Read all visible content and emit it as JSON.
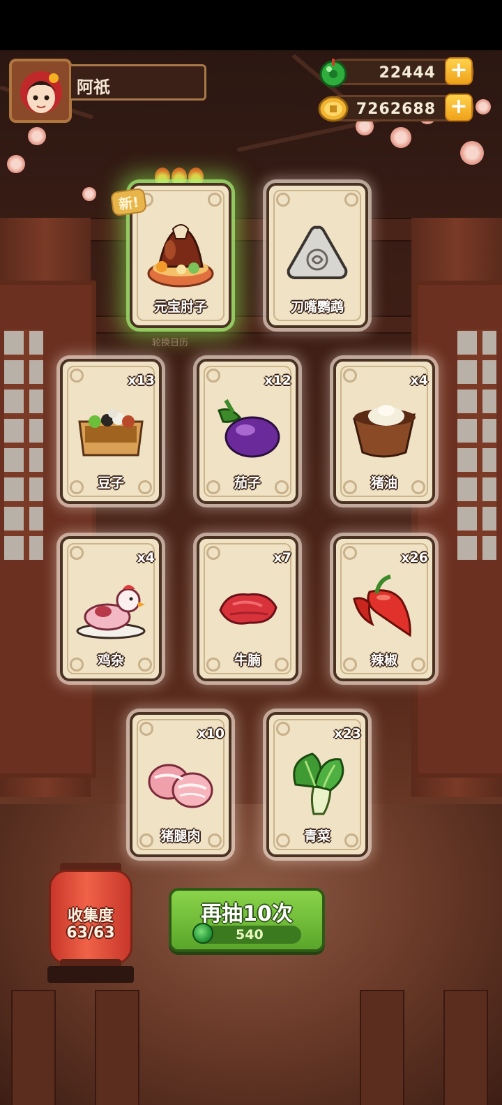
{
  "player": {
    "name": "阿祇",
    "avatar_icon": "chef-girl-avatar-icon"
  },
  "currencies": [
    {
      "name": "jade",
      "icon": "jade-coin-icon",
      "value": "22444",
      "color": "#2fae3e"
    },
    {
      "name": "gold",
      "icon": "gold-coin-icon",
      "value": "7262688",
      "color": "#f2b531"
    }
  ],
  "featured": {
    "new_badge": "新!",
    "calendar_label": "轮换日历",
    "cards": [
      {
        "name": "元宝肘子",
        "icon": "braised-pork-knuckle-icon",
        "highlight": true
      },
      {
        "name": "刀嘴鹦鹉",
        "icon": "locked-triangle-icon",
        "highlight": false
      }
    ]
  },
  "cards": [
    {
      "name": "豆子",
      "qty": "x13",
      "icon": "beans-box-icon"
    },
    {
      "name": "茄子",
      "qty": "x12",
      "icon": "eggplant-icon"
    },
    {
      "name": "猪油",
      "qty": "x4",
      "icon": "lard-bowl-icon"
    },
    {
      "name": "鸡杂",
      "qty": "x4",
      "icon": "chicken-giblets-icon"
    },
    {
      "name": "牛腩",
      "qty": "x7",
      "icon": "beef-brisket-icon"
    },
    {
      "name": "辣椒",
      "qty": "x26",
      "icon": "chili-pepper-icon"
    },
    {
      "name": "猪腿肉",
      "qty": "x10",
      "icon": "pork-leg-icon"
    },
    {
      "name": "青菜",
      "qty": "x23",
      "icon": "bok-choy-icon"
    }
  ],
  "collection": {
    "label": "收集度",
    "progress": "63/63"
  },
  "draw": {
    "label": "再抽10次",
    "cost": "540",
    "cost_icon": "jade-coin-icon"
  }
}
